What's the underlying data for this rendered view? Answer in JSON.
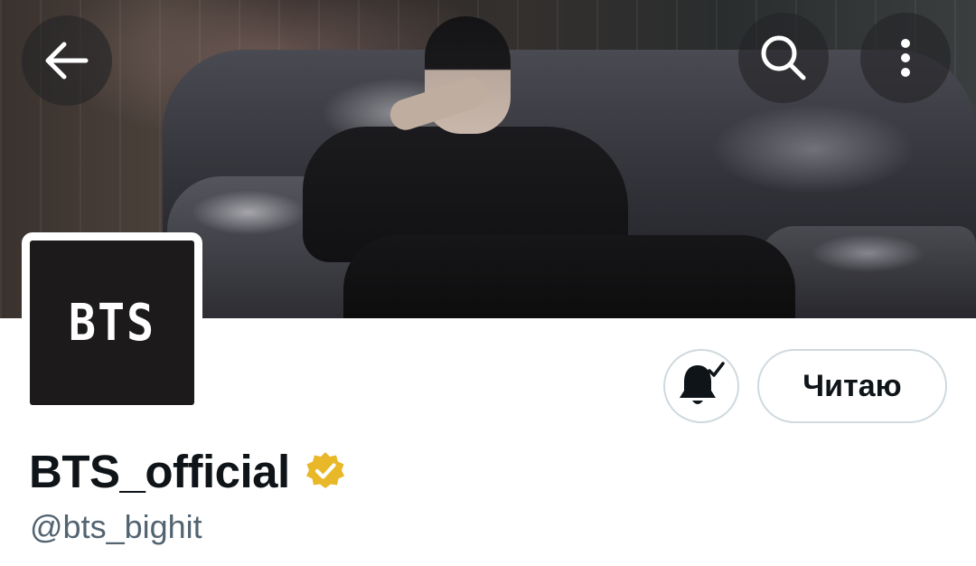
{
  "banner": {
    "alt": "profile-banner-photo"
  },
  "top_bar": {
    "back_icon": "arrow-left-icon",
    "search_icon": "search-icon",
    "more_icon": "more-vertical-icon"
  },
  "avatar": {
    "logo_text": "BTS"
  },
  "actions": {
    "notifications_icon": "bell-check-icon",
    "follow_label": "Читаю"
  },
  "profile": {
    "display_name": "BTS_official",
    "handle": "@bts_bighit",
    "verified": true,
    "verified_color": "#e8b829"
  },
  "colors": {
    "text_primary": "#0f1419",
    "text_secondary": "#536471",
    "button_border": "#cfd9de",
    "overlay_button": "#232326"
  }
}
